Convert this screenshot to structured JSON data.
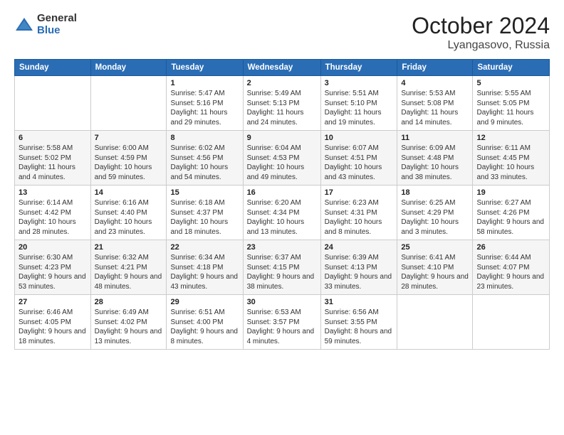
{
  "header": {
    "logo_general": "General",
    "logo_blue": "Blue",
    "title": "October 2024",
    "location": "Lyangasovo, Russia"
  },
  "weekdays": [
    "Sunday",
    "Monday",
    "Tuesday",
    "Wednesday",
    "Thursday",
    "Friday",
    "Saturday"
  ],
  "weeks": [
    [
      {
        "day": "",
        "info": ""
      },
      {
        "day": "",
        "info": ""
      },
      {
        "day": "1",
        "info": "Sunrise: 5:47 AM\nSunset: 5:16 PM\nDaylight: 11 hours and 29 minutes."
      },
      {
        "day": "2",
        "info": "Sunrise: 5:49 AM\nSunset: 5:13 PM\nDaylight: 11 hours and 24 minutes."
      },
      {
        "day": "3",
        "info": "Sunrise: 5:51 AM\nSunset: 5:10 PM\nDaylight: 11 hours and 19 minutes."
      },
      {
        "day": "4",
        "info": "Sunrise: 5:53 AM\nSunset: 5:08 PM\nDaylight: 11 hours and 14 minutes."
      },
      {
        "day": "5",
        "info": "Sunrise: 5:55 AM\nSunset: 5:05 PM\nDaylight: 11 hours and 9 minutes."
      }
    ],
    [
      {
        "day": "6",
        "info": "Sunrise: 5:58 AM\nSunset: 5:02 PM\nDaylight: 11 hours and 4 minutes."
      },
      {
        "day": "7",
        "info": "Sunrise: 6:00 AM\nSunset: 4:59 PM\nDaylight: 10 hours and 59 minutes."
      },
      {
        "day": "8",
        "info": "Sunrise: 6:02 AM\nSunset: 4:56 PM\nDaylight: 10 hours and 54 minutes."
      },
      {
        "day": "9",
        "info": "Sunrise: 6:04 AM\nSunset: 4:53 PM\nDaylight: 10 hours and 49 minutes."
      },
      {
        "day": "10",
        "info": "Sunrise: 6:07 AM\nSunset: 4:51 PM\nDaylight: 10 hours and 43 minutes."
      },
      {
        "day": "11",
        "info": "Sunrise: 6:09 AM\nSunset: 4:48 PM\nDaylight: 10 hours and 38 minutes."
      },
      {
        "day": "12",
        "info": "Sunrise: 6:11 AM\nSunset: 4:45 PM\nDaylight: 10 hours and 33 minutes."
      }
    ],
    [
      {
        "day": "13",
        "info": "Sunrise: 6:14 AM\nSunset: 4:42 PM\nDaylight: 10 hours and 28 minutes."
      },
      {
        "day": "14",
        "info": "Sunrise: 6:16 AM\nSunset: 4:40 PM\nDaylight: 10 hours and 23 minutes."
      },
      {
        "day": "15",
        "info": "Sunrise: 6:18 AM\nSunset: 4:37 PM\nDaylight: 10 hours and 18 minutes."
      },
      {
        "day": "16",
        "info": "Sunrise: 6:20 AM\nSunset: 4:34 PM\nDaylight: 10 hours and 13 minutes."
      },
      {
        "day": "17",
        "info": "Sunrise: 6:23 AM\nSunset: 4:31 PM\nDaylight: 10 hours and 8 minutes."
      },
      {
        "day": "18",
        "info": "Sunrise: 6:25 AM\nSunset: 4:29 PM\nDaylight: 10 hours and 3 minutes."
      },
      {
        "day": "19",
        "info": "Sunrise: 6:27 AM\nSunset: 4:26 PM\nDaylight: 9 hours and 58 minutes."
      }
    ],
    [
      {
        "day": "20",
        "info": "Sunrise: 6:30 AM\nSunset: 4:23 PM\nDaylight: 9 hours and 53 minutes."
      },
      {
        "day": "21",
        "info": "Sunrise: 6:32 AM\nSunset: 4:21 PM\nDaylight: 9 hours and 48 minutes."
      },
      {
        "day": "22",
        "info": "Sunrise: 6:34 AM\nSunset: 4:18 PM\nDaylight: 9 hours and 43 minutes."
      },
      {
        "day": "23",
        "info": "Sunrise: 6:37 AM\nSunset: 4:15 PM\nDaylight: 9 hours and 38 minutes."
      },
      {
        "day": "24",
        "info": "Sunrise: 6:39 AM\nSunset: 4:13 PM\nDaylight: 9 hours and 33 minutes."
      },
      {
        "day": "25",
        "info": "Sunrise: 6:41 AM\nSunset: 4:10 PM\nDaylight: 9 hours and 28 minutes."
      },
      {
        "day": "26",
        "info": "Sunrise: 6:44 AM\nSunset: 4:07 PM\nDaylight: 9 hours and 23 minutes."
      }
    ],
    [
      {
        "day": "27",
        "info": "Sunrise: 6:46 AM\nSunset: 4:05 PM\nDaylight: 9 hours and 18 minutes."
      },
      {
        "day": "28",
        "info": "Sunrise: 6:49 AM\nSunset: 4:02 PM\nDaylight: 9 hours and 13 minutes."
      },
      {
        "day": "29",
        "info": "Sunrise: 6:51 AM\nSunset: 4:00 PM\nDaylight: 9 hours and 8 minutes."
      },
      {
        "day": "30",
        "info": "Sunrise: 6:53 AM\nSunset: 3:57 PM\nDaylight: 9 hours and 4 minutes."
      },
      {
        "day": "31",
        "info": "Sunrise: 6:56 AM\nSunset: 3:55 PM\nDaylight: 8 hours and 59 minutes."
      },
      {
        "day": "",
        "info": ""
      },
      {
        "day": "",
        "info": ""
      }
    ]
  ]
}
